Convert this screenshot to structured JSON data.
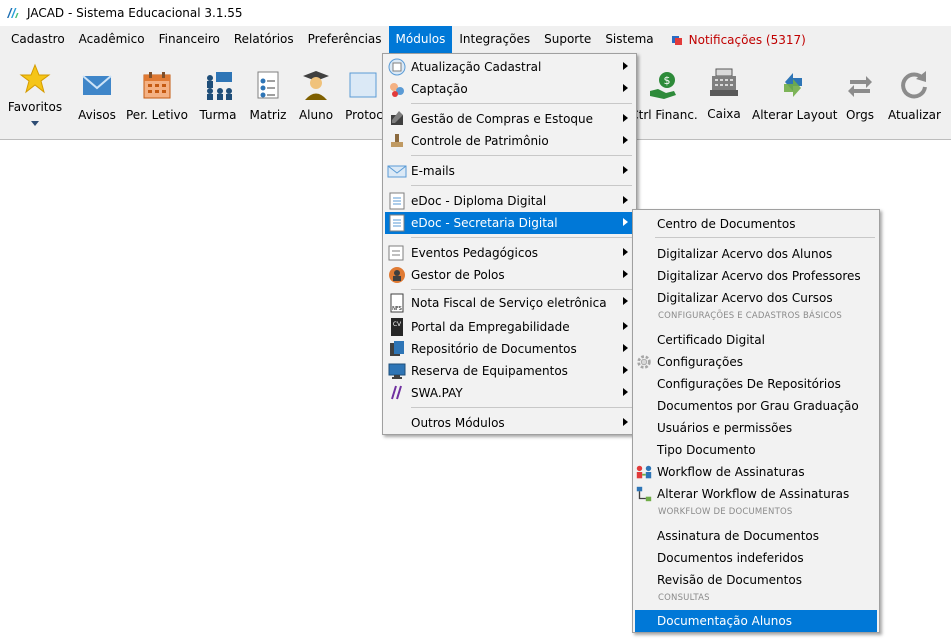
{
  "window": {
    "title": "JACAD - Sistema Educacional 3.1.55"
  },
  "menubar": {
    "items": [
      {
        "label": "Cadastro"
      },
      {
        "label": "Acadêmico"
      },
      {
        "label": "Financeiro"
      },
      {
        "label": "Relatórios"
      },
      {
        "label": "Preferências"
      },
      {
        "label": "Módulos"
      },
      {
        "label": "Integrações"
      },
      {
        "label": "Suporte"
      },
      {
        "label": "Sistema"
      }
    ],
    "notifications_label": "Notificações (5317)"
  },
  "toolbar": {
    "items": [
      {
        "label": "Favoritos",
        "icon": "star-icon"
      },
      {
        "label": "Avisos",
        "icon": "mail-icon"
      },
      {
        "label": "Per. Letivo",
        "icon": "calendar-icon"
      },
      {
        "label": "Turma",
        "icon": "class-icon"
      },
      {
        "label": "Matriz",
        "icon": "matrix-icon"
      },
      {
        "label": "Aluno",
        "icon": "student-icon"
      },
      {
        "label": "Protoc",
        "icon": "protocol-icon"
      },
      {
        "label": "Ctrl Financ.",
        "icon": "money-hand-icon"
      },
      {
        "label": "Caixa",
        "icon": "cash-register-icon"
      },
      {
        "label": "Alterar Layout",
        "icon": "switch-layout-icon"
      },
      {
        "label": "Orgs",
        "icon": "arrows-icon"
      },
      {
        "label": "Atualizar",
        "icon": "refresh-icon"
      }
    ]
  },
  "modulos_menu": {
    "items": [
      {
        "label": "Atualização Cadastral",
        "icon": "form-icon"
      },
      {
        "label": "Captação",
        "icon": "people-target-icon"
      },
      {
        "label": "Gestão de Compras e Estoque",
        "icon": "pen-box-icon"
      },
      {
        "label": "Controle de Patrimônio",
        "icon": "stamp-icon"
      },
      {
        "label": "E-mails",
        "icon": "envelope-icon"
      },
      {
        "label": "eDoc - Diploma Digital",
        "icon": "document-icon"
      },
      {
        "label": "eDoc - Secretaria Digital",
        "icon": "document-icon"
      },
      {
        "label": "Eventos Pedagógicos",
        "icon": "events-icon"
      },
      {
        "label": "Gestor de Polos",
        "icon": "globe-people-icon"
      },
      {
        "label": "Nota Fiscal de Serviço eletrônica",
        "icon": "invoice-icon"
      },
      {
        "label": "Portal da Empregabilidade",
        "icon": "cv-icon"
      },
      {
        "label": "Repositório de Documentos",
        "icon": "repository-icon"
      },
      {
        "label": "Reserva de Equipamentos",
        "icon": "monitor-icon"
      },
      {
        "label": "SWA.PAY",
        "icon": "swapay-icon"
      },
      {
        "label": "Outros Módulos",
        "icon": ""
      }
    ]
  },
  "secretaria_menu": {
    "items": [
      {
        "label": "Centro de Documentos"
      },
      {
        "label": "Digitalizar Acervo dos Alunos"
      },
      {
        "label": "Digitalizar Acervo dos Professores"
      },
      {
        "label": "Digitalizar Acervo dos Cursos"
      },
      {
        "label": "Certificado Digital"
      },
      {
        "label": "Configurações",
        "icon": "gear-icon"
      },
      {
        "label": "Configurações De Repositórios"
      },
      {
        "label": "Documentos por Grau Graduação"
      },
      {
        "label": "Usuários e permissões"
      },
      {
        "label": "Tipo Documento"
      },
      {
        "label": "Workflow de Assinaturas",
        "icon": "workflow-icon"
      },
      {
        "label": "Alterar Workflow de Assinaturas",
        "icon": "workflow-edit-icon"
      },
      {
        "label": "Assinatura de Documentos"
      },
      {
        "label": "Documentos indeferidos"
      },
      {
        "label": "Revisão de Documentos"
      },
      {
        "label": "Documentação Alunos"
      }
    ],
    "headers": [
      "CONFIGURAÇÕES E CADASTROS BÁSICOS",
      "WORKFLOW DE DOCUMENTOS",
      "CONSULTAS"
    ]
  },
  "colors": {
    "selection": "#0078d7",
    "notification": "#c00000"
  }
}
